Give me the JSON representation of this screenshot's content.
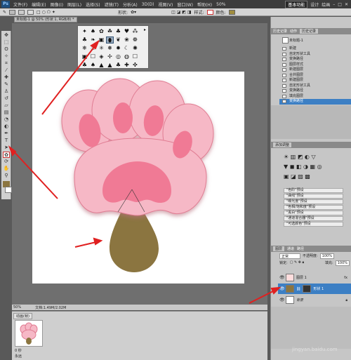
{
  "app": {
    "logo": "Ps",
    "menus": [
      "文件(F)",
      "编辑(E)",
      "图像(I)",
      "图层(L)",
      "选择(S)",
      "滤镜(T)",
      "分析(A)",
      "3D(D)",
      "视图(V)",
      "窗口(W)",
      "帮助(H)"
    ],
    "zoom": "50%",
    "workspace": "基本功能",
    "workspace_items": [
      "设计",
      "绘画"
    ]
  },
  "options": {
    "shape_label": "形状:",
    "style_label": "样式:",
    "color_label": "颜色:",
    "accent": "#a08d3e"
  },
  "document": {
    "tab_title": "未标题-1 @ 50% (形状 1, RGB/8) *",
    "zoom_status": "50%",
    "doc_size": "文档:1.49M/2.02M"
  },
  "artwork": {
    "paw_fill": "#f6b8c6",
    "paw_shadow": "#e07d93",
    "pad_fill": "#f07a95",
    "drop_fill": "#8b7540"
  },
  "history": {
    "tabs": [
      "历史记录",
      "动作",
      "历史记录"
    ],
    "snapshot": "未标题-1",
    "items": [
      "新建",
      "自定形状工具",
      "变换路径",
      "图层样式",
      "新建图层",
      "合并图层",
      "新建图层",
      "自定形状工具",
      "变换路径",
      "填充图层",
      "变换路径"
    ]
  },
  "adjustments": {
    "title": "添加调整",
    "presets": [
      "\"色阶\"预设",
      "\"曲线\"预设",
      "\"曝光度\"预设",
      "\"色相/饱和度\"预设",
      "\"黑白\"预设",
      "\"通道混合器\"预设",
      "\"可选颜色\"预设"
    ]
  },
  "layers": {
    "tabs": [
      "图层",
      "通道",
      "路径"
    ],
    "blend_mode": "正常",
    "opacity_label": "不透明度:",
    "opacity": "100%",
    "lock_label": "锁定:",
    "fill_label": "填充:",
    "fill": "100%",
    "items": [
      {
        "name": "图层 1",
        "selected": false,
        "fx": "fx"
      },
      {
        "name": "形状 1",
        "selected": true,
        "fx": ""
      },
      {
        "name": "背景",
        "selected": false,
        "fx": ""
      }
    ]
  },
  "bottom": {
    "tabs": [
      "动画(帧)"
    ],
    "frame_label": "0 秒",
    "loop": "永远"
  },
  "watermark": "jingyan.baidu.com"
}
